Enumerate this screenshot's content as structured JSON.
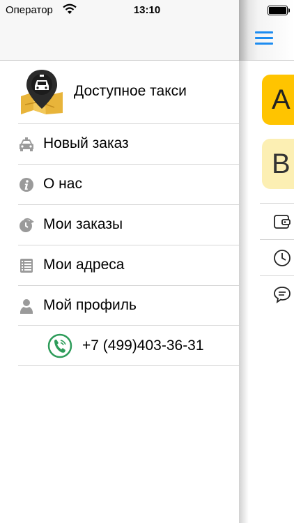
{
  "status_bar": {
    "carrier": "Оператор",
    "time": "13:10"
  },
  "menu": {
    "brand_title": "Доступное такси",
    "items": [
      {
        "label": "Новый заказ",
        "icon": "car-icon"
      },
      {
        "label": "О нас",
        "icon": "info-icon"
      },
      {
        "label": "Мои заказы",
        "icon": "clock-arrow-icon"
      },
      {
        "label": "Мои адреса",
        "icon": "list-icon"
      },
      {
        "label": "Мой профиль",
        "icon": "person-icon"
      }
    ],
    "phone": "+7 (499)403-36-31"
  },
  "main": {
    "address_a_label": "A",
    "address_b_label": "B",
    "accent_color": "#1d8cf0",
    "address_a_color": "#ffc400",
    "address_b_color": "#fcefb3"
  }
}
